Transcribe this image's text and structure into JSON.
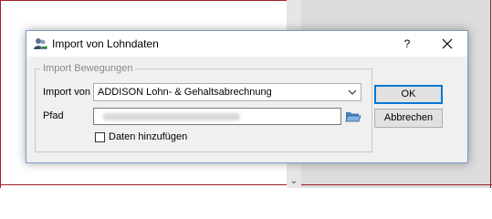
{
  "dialog": {
    "title": "Import von Lohndaten",
    "help_label": "?",
    "group_title": "Import Bewegungen",
    "import_label": "Import von",
    "import_value": "ADDISON Lohn- & Gehaltsabrechnung",
    "path_label": "Pfad",
    "append_label": "Daten hinzufügen",
    "append_checked": false,
    "ok_label": "OK",
    "cancel_label": "Abbrechen"
  },
  "icons": {
    "title": "users-import-icon",
    "close": "close-icon",
    "dropdown": "chevron-down-icon",
    "browse": "folder-open-icon",
    "scroll": "scroll-down-arrow-icon"
  },
  "colors": {
    "accent": "#0078d7",
    "frame_red": "#a0202a",
    "dialog_bg": "#f0f0f0"
  },
  "background": {
    "scroll_arrow": "⌄"
  }
}
